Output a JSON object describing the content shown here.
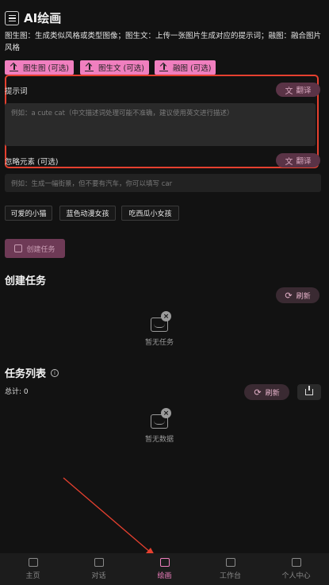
{
  "header": {
    "title": "AI绘画"
  },
  "description": "图生图：生成类似风格或类型图像；图生文：上传一张图片生成对应的提示词；融图：融合图片风格",
  "mode_buttons": [
    {
      "label": "图生图 (可选)"
    },
    {
      "label": "图生文 (可选)"
    },
    {
      "label": "融图 (可选)"
    }
  ],
  "prompt": {
    "label": "提示词",
    "translate_label": "翻译",
    "placeholder": "例如：a cute cat（中文描述词处理可能不准确，建议使用英文进行描述）"
  },
  "negative": {
    "label": "忽略元素 (可选)",
    "translate_label": "翻译",
    "placeholder": "例如：生成一幅街景，但不要有汽车，你可以填写 car"
  },
  "tags": [
    "可爱的小猫",
    "蓝色动漫女孩",
    "吃西瓜小女孩"
  ],
  "create_button": "创建任务",
  "create_section": {
    "title": "创建任务",
    "refresh_label": "刷新",
    "empty_text": "暂无任务"
  },
  "task_section": {
    "title": "任务列表",
    "total": "总计: 0",
    "refresh_label": "刷新",
    "empty_text": "暂无数据"
  },
  "tabbar": {
    "items": [
      {
        "label": "主页",
        "icon": "home-icon",
        "active": false
      },
      {
        "label": "对话",
        "icon": "chat-icon",
        "active": false
      },
      {
        "label": "绘画",
        "icon": "paint-icon",
        "active": true
      },
      {
        "label": "工作台",
        "icon": "workbench-icon",
        "active": false
      },
      {
        "label": "个人中心",
        "icon": "profile-icon",
        "active": false
      }
    ]
  },
  "colors": {
    "accent": "#f07fbf",
    "highlight_border": "#e5402f",
    "annotation_arrow": "#e5402f"
  }
}
